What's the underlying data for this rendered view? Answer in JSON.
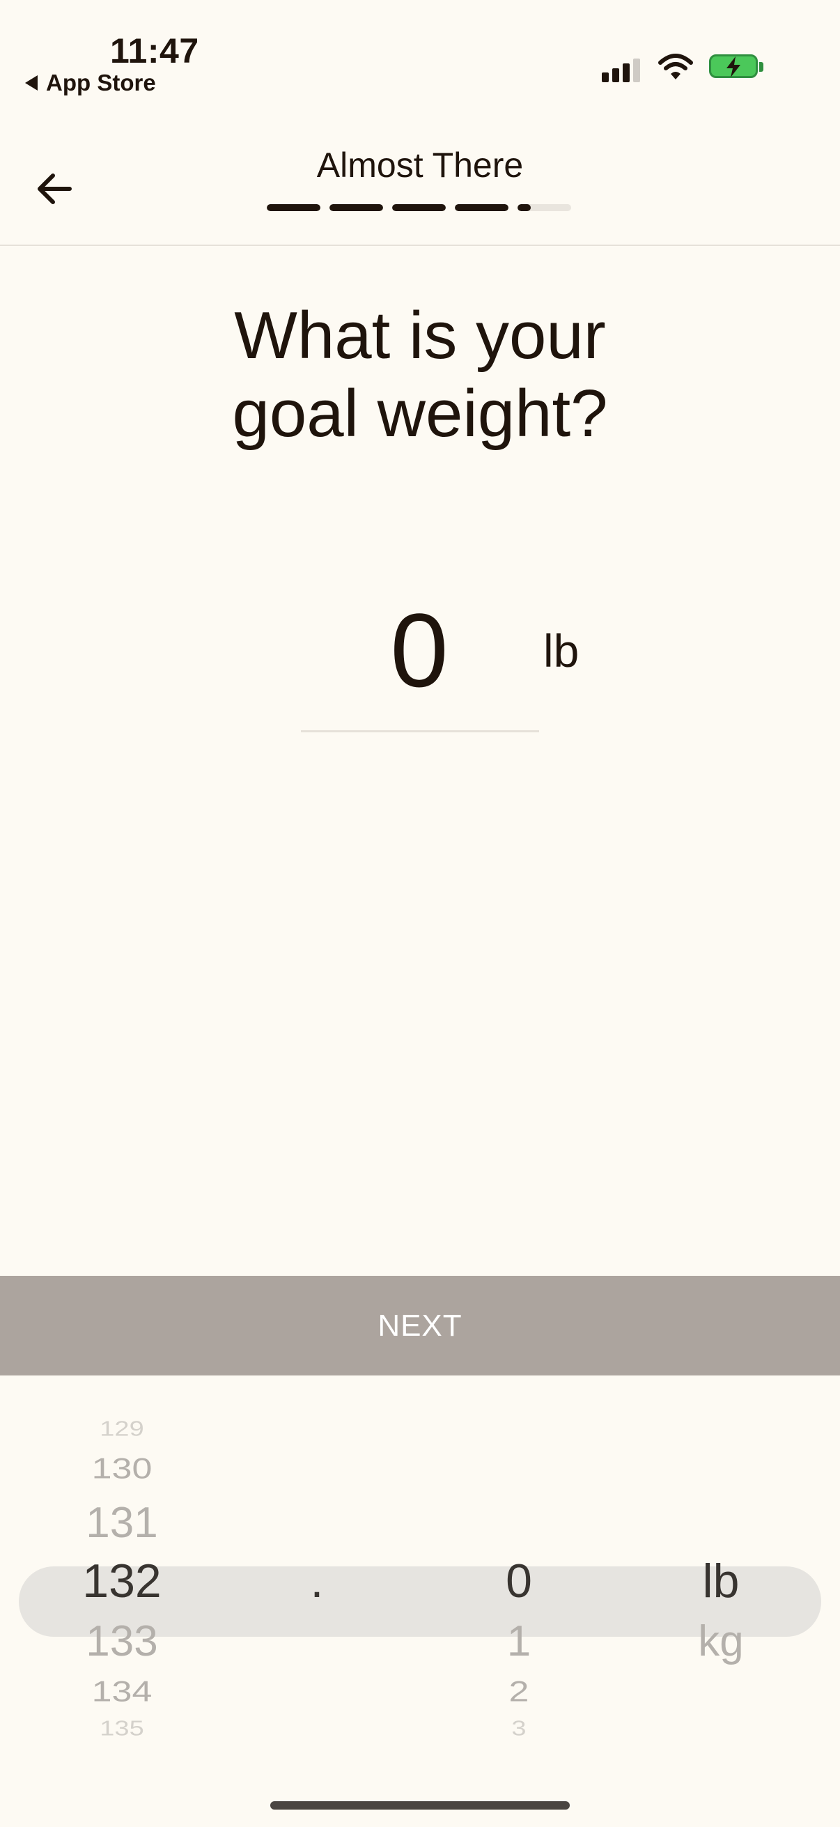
{
  "status_bar": {
    "time": "11:47",
    "back_app": "App Store",
    "signal_icon": "cellular-signal-icon",
    "wifi_icon": "wifi-icon",
    "battery_icon": "battery-charging-icon",
    "battery_color": "#4bc85a"
  },
  "header": {
    "title": "Almost There",
    "back_icon": "arrow-left-icon",
    "progress": {
      "segments": 5,
      "completed_fraction": 0.85
    }
  },
  "question": {
    "line1": "What is your",
    "line2": "goal weight?"
  },
  "value": {
    "number": "0",
    "unit": "lb"
  },
  "next_button": {
    "label": "NEXT",
    "background": "#aca49e"
  },
  "picker": {
    "whole": [
      "129",
      "130",
      "131",
      "132",
      "133",
      "134",
      "135"
    ],
    "whole_selected": "132",
    "separator": ".",
    "decimal": [
      "0",
      "1",
      "2",
      "3"
    ],
    "decimal_selected": "0",
    "units": [
      "lb",
      "kg"
    ],
    "unit_selected": "lb"
  },
  "colors": {
    "background": "#fdfaf3",
    "text": "#1f140c",
    "picker_highlight": "#e6e4e0"
  }
}
